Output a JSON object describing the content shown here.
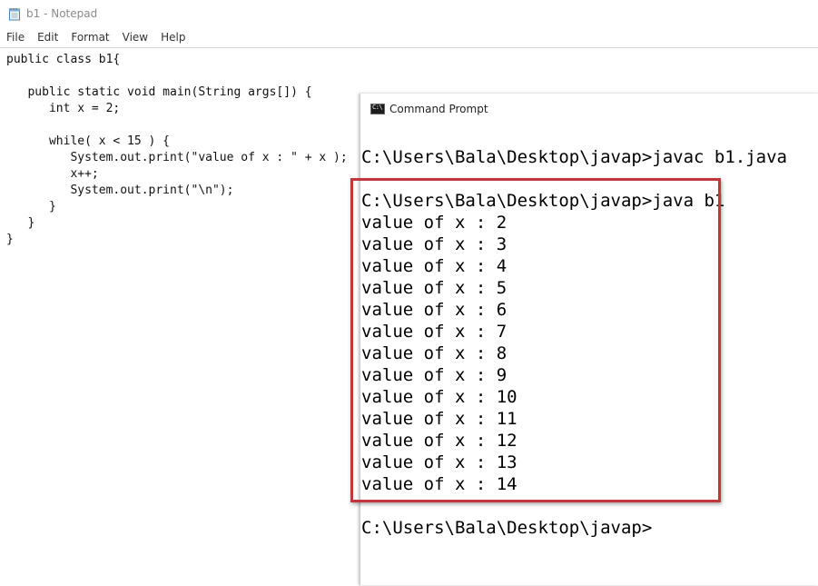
{
  "notepad": {
    "title": "b1 - Notepad",
    "menu": [
      "File",
      "Edit",
      "Format",
      "View",
      "Help"
    ],
    "code": [
      "public class b1{",
      "",
      "   public static void main(String args[]) {",
      "      int x = 2;",
      "",
      "      while( x < 15 ) {",
      "         System.out.print(\"value of x : \" + x );",
      "         x++;",
      "         System.out.print(\"\\n\");",
      "      }",
      "   }",
      "}"
    ]
  },
  "cmd": {
    "title": "Command Prompt",
    "lines": [
      "C:\\Users\\Bala\\Desktop\\javap>javac b1.java",
      "",
      "C:\\Users\\Bala\\Desktop\\javap>java b1",
      "value of x : 2",
      "value of x : 3",
      "value of x : 4",
      "value of x : 5",
      "value of x : 6",
      "value of x : 7",
      "value of x : 8",
      "value of x : 9",
      "value of x : 10",
      "value of x : 11",
      "value of x : 12",
      "value of x : 13",
      "value of x : 14",
      "",
      "C:\\Users\\Bala\\Desktop\\javap>"
    ]
  },
  "colors": {
    "highlight_border": "#c2373a",
    "cmd_text": "#000000",
    "notepad_title_text": "#8a8a8a"
  },
  "icons": {
    "notepad": "notepad-icon",
    "cmd": "cmd-icon"
  }
}
